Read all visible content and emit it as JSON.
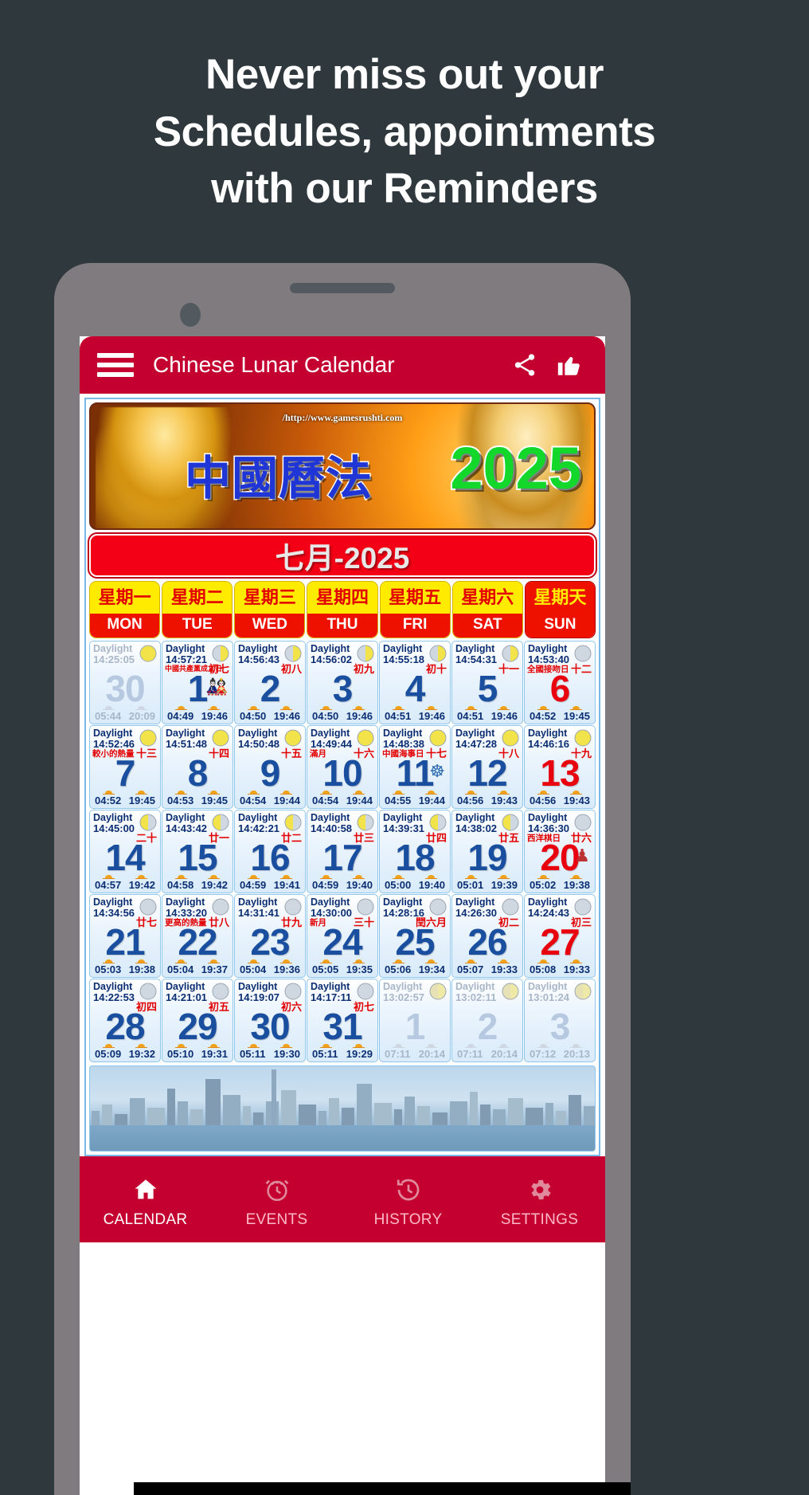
{
  "promo": {
    "headline_lines": [
      "Never miss out your",
      "Schedules, appointments",
      "with our Reminders"
    ]
  },
  "appbar": {
    "menu_icon": "hamburger-menu-icon",
    "title": "Chinese Lunar Calendar",
    "share_icon": "share-icon",
    "like_icon": "thumbs-up-icon"
  },
  "banner": {
    "url": "/http://www.gamesrushti.com",
    "chinese_title": "中國曆法",
    "year": "2025"
  },
  "month_header": "七月-2025",
  "weekdays": [
    {
      "cn": "星期一",
      "en": "MON"
    },
    {
      "cn": "星期二",
      "en": "TUE"
    },
    {
      "cn": "星期三",
      "en": "WED"
    },
    {
      "cn": "星期四",
      "en": "THU"
    },
    {
      "cn": "星期五",
      "en": "FRI"
    },
    {
      "cn": "星期六",
      "en": "SAT"
    },
    {
      "cn": "星期天",
      "en": "SUN"
    }
  ],
  "daylight_label": "Daylight",
  "weeks": [
    [
      {
        "day": "30",
        "daylight": "14:25:05",
        "lunar": "",
        "festival": "",
        "sunrise": "05:44",
        "sunset": "20:09",
        "other_month": true,
        "moon": "full-yellow",
        "icon": ""
      },
      {
        "day": "1",
        "daylight": "14:57:21",
        "lunar": "初七",
        "festival": "中國共產黨成立日",
        "sunrise": "04:49",
        "sunset": "19:46",
        "other_month": false,
        "moon": "half-right",
        "icon": "🎎"
      },
      {
        "day": "2",
        "daylight": "14:56:43",
        "lunar": "初八",
        "festival": "",
        "sunrise": "04:50",
        "sunset": "19:46",
        "other_month": false,
        "moon": "half-right",
        "icon": ""
      },
      {
        "day": "3",
        "daylight": "14:56:02",
        "lunar": "初九",
        "festival": "",
        "sunrise": "04:50",
        "sunset": "19:46",
        "other_month": false,
        "moon": "half-right",
        "icon": ""
      },
      {
        "day": "4",
        "daylight": "14:55:18",
        "lunar": "初十",
        "festival": "",
        "sunrise": "04:51",
        "sunset": "19:46",
        "other_month": false,
        "moon": "half-right",
        "icon": ""
      },
      {
        "day": "5",
        "daylight": "14:54:31",
        "lunar": "十一",
        "festival": "",
        "sunrise": "04:51",
        "sunset": "19:46",
        "other_month": false,
        "moon": "half-right",
        "icon": ""
      },
      {
        "day": "6",
        "daylight": "14:53:40",
        "lunar": "十二",
        "festival": "全國接吻日",
        "sunrise": "04:52",
        "sunset": "19:45",
        "other_month": false,
        "sunday": true,
        "moon": "gibbous",
        "icon": ""
      }
    ],
    [
      {
        "day": "7",
        "daylight": "14:52:46",
        "lunar": "十三",
        "festival": "較小的熱量",
        "sunrise": "04:52",
        "sunset": "19:45",
        "other_month": false,
        "moon": "full-yellow",
        "icon": ""
      },
      {
        "day": "8",
        "daylight": "14:51:48",
        "lunar": "十四",
        "festival": "",
        "sunrise": "04:53",
        "sunset": "19:45",
        "other_month": false,
        "moon": "full-yellow",
        "icon": ""
      },
      {
        "day": "9",
        "daylight": "14:50:48",
        "lunar": "十五",
        "festival": "",
        "sunrise": "04:54",
        "sunset": "19:44",
        "other_month": false,
        "moon": "full-yellow",
        "icon": ""
      },
      {
        "day": "10",
        "daylight": "14:49:44",
        "lunar": "十六",
        "festival": "滿月",
        "sunrise": "04:54",
        "sunset": "19:44",
        "other_month": false,
        "moon": "full-yellow",
        "icon": ""
      },
      {
        "day": "11",
        "daylight": "14:48:38",
        "lunar": "十七",
        "festival": "中國海事日",
        "sunrise": "04:55",
        "sunset": "19:44",
        "other_month": false,
        "moon": "full-yellow",
        "icon": "☸"
      },
      {
        "day": "12",
        "daylight": "14:47:28",
        "lunar": "十八",
        "festival": "",
        "sunrise": "04:56",
        "sunset": "19:43",
        "other_month": false,
        "moon": "full-yellow",
        "icon": ""
      },
      {
        "day": "13",
        "daylight": "14:46:16",
        "lunar": "十九",
        "festival": "",
        "sunrise": "04:56",
        "sunset": "19:43",
        "other_month": false,
        "sunday": true,
        "moon": "full-yellow",
        "icon": ""
      }
    ],
    [
      {
        "day": "14",
        "daylight": "14:45:00",
        "lunar": "二十",
        "festival": "",
        "sunrise": "04:57",
        "sunset": "19:42",
        "other_month": false,
        "moon": "half-left",
        "icon": ""
      },
      {
        "day": "15",
        "daylight": "14:43:42",
        "lunar": "廿一",
        "festival": "",
        "sunrise": "04:58",
        "sunset": "19:42",
        "other_month": false,
        "moon": "half-left",
        "icon": ""
      },
      {
        "day": "16",
        "daylight": "14:42:21",
        "lunar": "廿二",
        "festival": "",
        "sunrise": "04:59",
        "sunset": "19:41",
        "other_month": false,
        "moon": "half-left",
        "icon": ""
      },
      {
        "day": "17",
        "daylight": "14:40:58",
        "lunar": "廿三",
        "festival": "",
        "sunrise": "04:59",
        "sunset": "19:40",
        "other_month": false,
        "moon": "half-left",
        "icon": ""
      },
      {
        "day": "18",
        "daylight": "14:39:31",
        "lunar": "廿四",
        "festival": "",
        "sunrise": "05:00",
        "sunset": "19:40",
        "other_month": false,
        "moon": "half-left",
        "icon": ""
      },
      {
        "day": "19",
        "daylight": "14:38:02",
        "lunar": "廿五",
        "festival": "",
        "sunrise": "05:01",
        "sunset": "19:39",
        "other_month": false,
        "moon": "half-left",
        "icon": ""
      },
      {
        "day": "20",
        "daylight": "14:36:30",
        "lunar": "廿六",
        "festival": "西洋棋日",
        "sunrise": "05:02",
        "sunset": "19:38",
        "other_month": false,
        "sunday": true,
        "moon": "crescent",
        "icon": "♟"
      }
    ],
    [
      {
        "day": "21",
        "daylight": "14:34:56",
        "lunar": "廿七",
        "festival": "",
        "sunrise": "05:03",
        "sunset": "19:38",
        "other_month": false,
        "moon": "crescent",
        "icon": ""
      },
      {
        "day": "22",
        "daylight": "14:33:20",
        "lunar": "廿八",
        "festival": "更高的熱量",
        "sunrise": "05:04",
        "sunset": "19:37",
        "other_month": false,
        "moon": "crescent",
        "icon": ""
      },
      {
        "day": "23",
        "daylight": "14:31:41",
        "lunar": "廿九",
        "festival": "",
        "sunrise": "05:04",
        "sunset": "19:36",
        "other_month": false,
        "moon": "crescent",
        "icon": ""
      },
      {
        "day": "24",
        "daylight": "14:30:00",
        "lunar": "三十",
        "festival": "新月",
        "sunrise": "05:05",
        "sunset": "19:35",
        "other_month": false,
        "moon": "new",
        "icon": ""
      },
      {
        "day": "25",
        "daylight": "14:28:16",
        "lunar": "閏六月",
        "festival": "",
        "sunrise": "05:06",
        "sunset": "19:34",
        "other_month": false,
        "moon": "new",
        "icon": ""
      },
      {
        "day": "26",
        "daylight": "14:26:30",
        "lunar": "初二",
        "festival": "",
        "sunrise": "05:07",
        "sunset": "19:33",
        "other_month": false,
        "moon": "new",
        "icon": ""
      },
      {
        "day": "27",
        "daylight": "14:24:43",
        "lunar": "初三",
        "festival": "",
        "sunrise": "05:08",
        "sunset": "19:33",
        "other_month": false,
        "sunday": true,
        "moon": "new",
        "icon": ""
      }
    ],
    [
      {
        "day": "28",
        "daylight": "14:22:53",
        "lunar": "初四",
        "festival": "",
        "sunrise": "05:09",
        "sunset": "19:32",
        "other_month": false,
        "moon": "crescent-right",
        "icon": ""
      },
      {
        "day": "29",
        "daylight": "14:21:01",
        "lunar": "初五",
        "festival": "",
        "sunrise": "05:10",
        "sunset": "19:31",
        "other_month": false,
        "moon": "crescent-right",
        "icon": ""
      },
      {
        "day": "30",
        "daylight": "14:19:07",
        "lunar": "初六",
        "festival": "",
        "sunrise": "05:11",
        "sunset": "19:30",
        "other_month": false,
        "moon": "crescent-right",
        "icon": ""
      },
      {
        "day": "31",
        "daylight": "14:17:11",
        "lunar": "初七",
        "festival": "",
        "sunrise": "05:11",
        "sunset": "19:29",
        "other_month": false,
        "moon": "crescent-right",
        "icon": ""
      },
      {
        "day": "1",
        "daylight": "13:02:57",
        "lunar": "",
        "festival": "",
        "sunrise": "07:11",
        "sunset": "20:14",
        "other_month": true,
        "moon": "half-pale",
        "icon": ""
      },
      {
        "day": "2",
        "daylight": "13:02:11",
        "lunar": "",
        "festival": "",
        "sunrise": "07:11",
        "sunset": "20:14",
        "other_month": true,
        "moon": "half-pale",
        "icon": ""
      },
      {
        "day": "3",
        "daylight": "13:01:24",
        "lunar": "",
        "festival": "",
        "sunrise": "07:12",
        "sunset": "20:13",
        "other_month": true,
        "moon": "half-pale",
        "icon": ""
      }
    ]
  ],
  "bottom_nav": [
    {
      "label": "CALENDAR",
      "icon": "home-icon",
      "active": true
    },
    {
      "label": "EVENTS",
      "icon": "alarm-icon",
      "active": false
    },
    {
      "label": "HISTORY",
      "icon": "history-clock-icon",
      "active": false
    },
    {
      "label": "SETTINGS",
      "icon": "gear-icon",
      "active": false
    }
  ],
  "colors": {
    "brand_red": "#c3002f",
    "header_yellow": "#ffeb00",
    "day_blue": "#1a4fa0",
    "sunday_red": "#e8000e",
    "page_bg": "#2f383d"
  }
}
